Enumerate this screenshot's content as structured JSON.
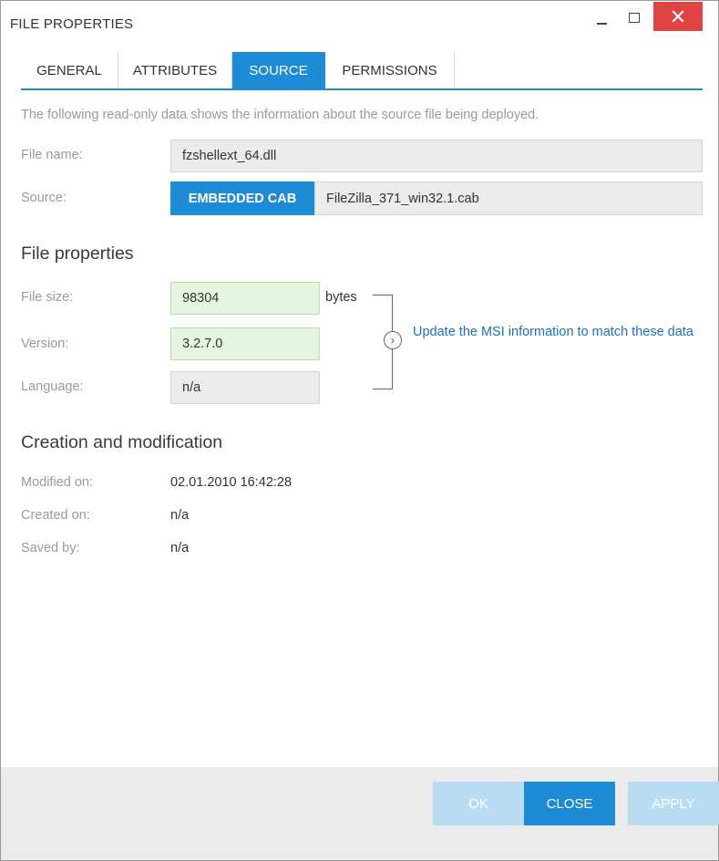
{
  "window": {
    "title": "FILE PROPERTIES"
  },
  "tabs": [
    {
      "label": "GENERAL",
      "active": false
    },
    {
      "label": "ATTRIBUTES",
      "active": false
    },
    {
      "label": "SOURCE",
      "active": true
    },
    {
      "label": "PERMISSIONS",
      "active": false
    }
  ],
  "description": "The following read-only data shows the information about the source file being deployed.",
  "source_info": {
    "file_name_label": "File name:",
    "file_name_value": "fzshellext_64.dll",
    "source_label": "Source:",
    "source_badge": "EMBEDDED CAB",
    "source_value": "FileZilla_371_win32.1.cab"
  },
  "file_properties": {
    "heading": "File properties",
    "file_size_label": "File size:",
    "file_size_value": "98304",
    "file_size_unit": "bytes",
    "version_label": "Version:",
    "version_value": "3.2.7.0",
    "language_label": "Language:",
    "language_value": "n/a",
    "update_link": "Update the MSI information to match these data"
  },
  "creation": {
    "heading": "Creation and modification",
    "modified_label": "Modified on:",
    "modified_value": "02.01.2010 16:42:28",
    "created_label": "Created on:",
    "created_value": "n/a",
    "saved_label": "Saved by:",
    "saved_value": "n/a"
  },
  "footer": {
    "ok_label": "OK",
    "close_label": "CLOSE",
    "apply_label": "APPLY"
  },
  "colors": {
    "accent": "#1e8bd6",
    "close_button": "#e04343",
    "highlight_field": "#e6f5e1",
    "link": "#1e6fc0"
  },
  "icons": {
    "minimize": "minimize-icon",
    "maximize": "maximize-icon",
    "close": "close-icon",
    "arrow": "chevron-right-circle-icon"
  }
}
